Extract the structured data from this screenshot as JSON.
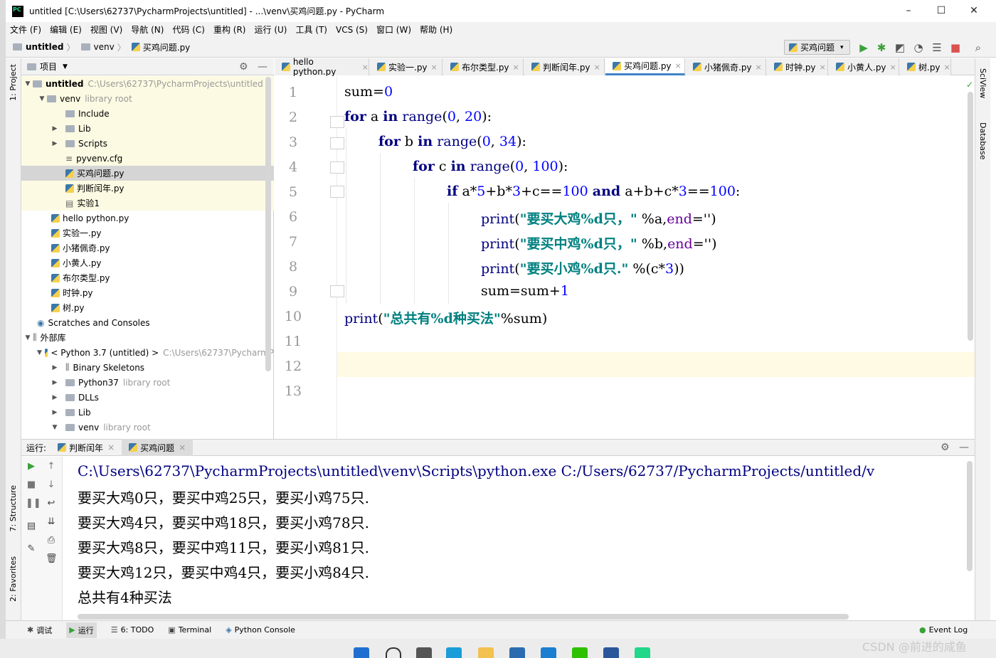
{
  "window": {
    "title": "untitled [C:\\Users\\62737\\PycharmProjects\\untitled] - ...\\venv\\买鸡问题.py - PyCharm"
  },
  "menu": [
    "文件 (F)",
    "编辑 (E)",
    "视图 (V)",
    "导航 (N)",
    "代码 (C)",
    "重构 (R)",
    "运行 (U)",
    "工具 (T)",
    "VCS (S)",
    "窗口 (W)",
    "帮助 (H)"
  ],
  "breadcrumb": [
    "untitled",
    "venv",
    "买鸡问题.py"
  ],
  "run_config": "买鸡问题",
  "project_panel": {
    "title": "项目"
  },
  "tree": [
    {
      "label": "untitled",
      "hint": "C:\\Users\\62737\\PycharmProjects\\untitled"
    },
    {
      "label": "venv",
      "hint": "library root"
    },
    {
      "label": "Include"
    },
    {
      "label": "Lib"
    },
    {
      "label": "Scripts"
    },
    {
      "label": "pyvenv.cfg"
    },
    {
      "label": "买鸡问题.py"
    },
    {
      "label": "判断闰年.py"
    },
    {
      "label": "实验1"
    },
    {
      "label": "hello python.py"
    },
    {
      "label": "实验一.py"
    },
    {
      "label": "小猪佩奇.py"
    },
    {
      "label": "小黄人.py"
    },
    {
      "label": "布尔类型.py"
    },
    {
      "label": "时钟.py"
    },
    {
      "label": "树.py"
    },
    {
      "label": "Scratches and Consoles"
    },
    {
      "label": "外部库"
    },
    {
      "label": "< Python 3.7 (untitled) >",
      "hint": "C:\\Users\\62737\\PycharmP"
    },
    {
      "label": "Binary Skeletons"
    },
    {
      "label": "Python37",
      "hint": "library root"
    },
    {
      "label": "DLLs"
    },
    {
      "label": "Lib"
    },
    {
      "label": "venv",
      "hint": "library root"
    }
  ],
  "tabs": [
    "hello python.py",
    "实验一.py",
    "布尔类型.py",
    "判断闰年.py",
    "买鸡问题.py",
    "小猪佩奇.py",
    "时钟.py",
    "小黄人.py",
    "树.py"
  ],
  "code": {
    "line_numbers": [
      "1",
      "2",
      "3",
      "4",
      "5",
      "6",
      "7",
      "8",
      "9",
      "10",
      "11",
      "12",
      "13"
    ],
    "l1_a": "sum=",
    "l1_b": "0",
    "for": "for",
    "in": "in",
    "range": "range",
    "if": "if",
    "and": "and",
    "print": "print",
    "end": "end",
    "l2_var": " a ",
    "l2_args_a": "(",
    "l2_n1": "0",
    "l2_comma": ", ",
    "l2_n2": "20",
    "l2_close": "):",
    "l3_var": " b ",
    "l3_n2": "34",
    "l4_var": " c ",
    "l4_n2": "100",
    "l5_a": " a*",
    "l5_5": "5",
    "l5_b": "+b*",
    "l5_3": "3",
    "l5_c": "+c==",
    "l5_100": "100",
    "l5_d": " a+b+c*",
    "l5_3b": "3",
    "l5_e": "==",
    "l5_100b": "100",
    "l5_colon": ":",
    "l6_str": "\"要买大鸡%d只，\"",
    "l6_rest": " %a,",
    "l6_end_val": "='')",
    "l7_str": "\"要买中鸡%d只，\"",
    "l7_rest": " %b,",
    "l7_end_val": "='')",
    "l8_str": "\"要买小鸡%d只.\"",
    "l8_rest": " %(c*",
    "l8_3": "3",
    "l8_close": "))",
    "l9": "sum=sum+",
    "l9_1": "1",
    "l10_str": "\"总共有%d种买法\"",
    "l10_rest": "%sum)"
  },
  "run_panel": {
    "label": "运行:",
    "tabs": [
      "判断闰年",
      "买鸡问题"
    ]
  },
  "console": [
    "C:\\Users\\62737\\PycharmProjects\\untitled\\venv\\Scripts\\python.exe C:/Users/62737/PycharmProjects/untitled/v",
    "要买大鸡0只，要买中鸡25只，要买小鸡75只.",
    "要买大鸡4只，要买中鸡18只，要买小鸡78只.",
    "要买大鸡8只，要买中鸡11只，要买小鸡81只.",
    "要买大鸡12只，要买中鸡4只，要买小鸡84只.",
    "总共有4种买法"
  ],
  "side_left": [
    "1: Project",
    "7: Structure",
    "2: Favorites"
  ],
  "side_right": [
    "SciView",
    "Database"
  ],
  "bottom_tools": [
    "调试",
    "运行",
    "6: TODO",
    "Terminal",
    "Python Console"
  ],
  "event_log": "Event Log",
  "watermark": "CSDN @前进的咸鱼"
}
